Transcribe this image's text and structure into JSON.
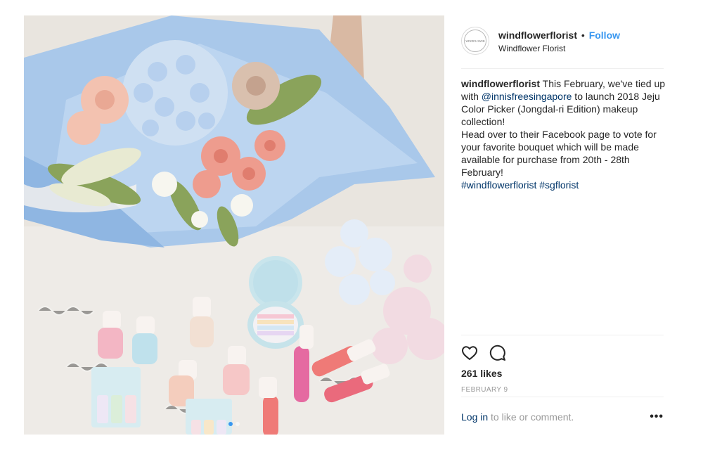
{
  "post": {
    "image_alt": "Pastel flower bouquet with innisfree Jeju Color Picker makeup on a white fur rug",
    "carousel": {
      "count": 2,
      "active": 0
    }
  },
  "header": {
    "avatar_text": "WINDFLOWER",
    "username": "windflowerflorist",
    "separator": "•",
    "follow_label": "Follow",
    "full_name": "Windflower Florist"
  },
  "caption": {
    "username": "windflowerflorist",
    "text_1": " This February, we've tied up with ",
    "mention": "@innisfreesingapore",
    "text_2": " to launch 2018 Jeju Color Picker (Jongdal-ri Edition) makeup collection!",
    "text_3": "Head over to their Facebook page to vote for your favorite bouquet which will be made available for purchase from 20th - 28th February!",
    "hashtag_1": "#windflowerflorist",
    "hashtag_2": "#sgflorist"
  },
  "actions": {
    "like_icon": "heart-icon",
    "comment_icon": "comment-icon",
    "likes": "261 likes",
    "date": "FEBRUARY 9"
  },
  "footer": {
    "login_label": "Log in",
    "prompt": " to like or comment.",
    "more_label": "•••"
  },
  "colors": {
    "link_blue": "#3897f0",
    "dark_link": "#003569",
    "text": "#262626",
    "muted": "#999999",
    "divider": "#efefef"
  }
}
